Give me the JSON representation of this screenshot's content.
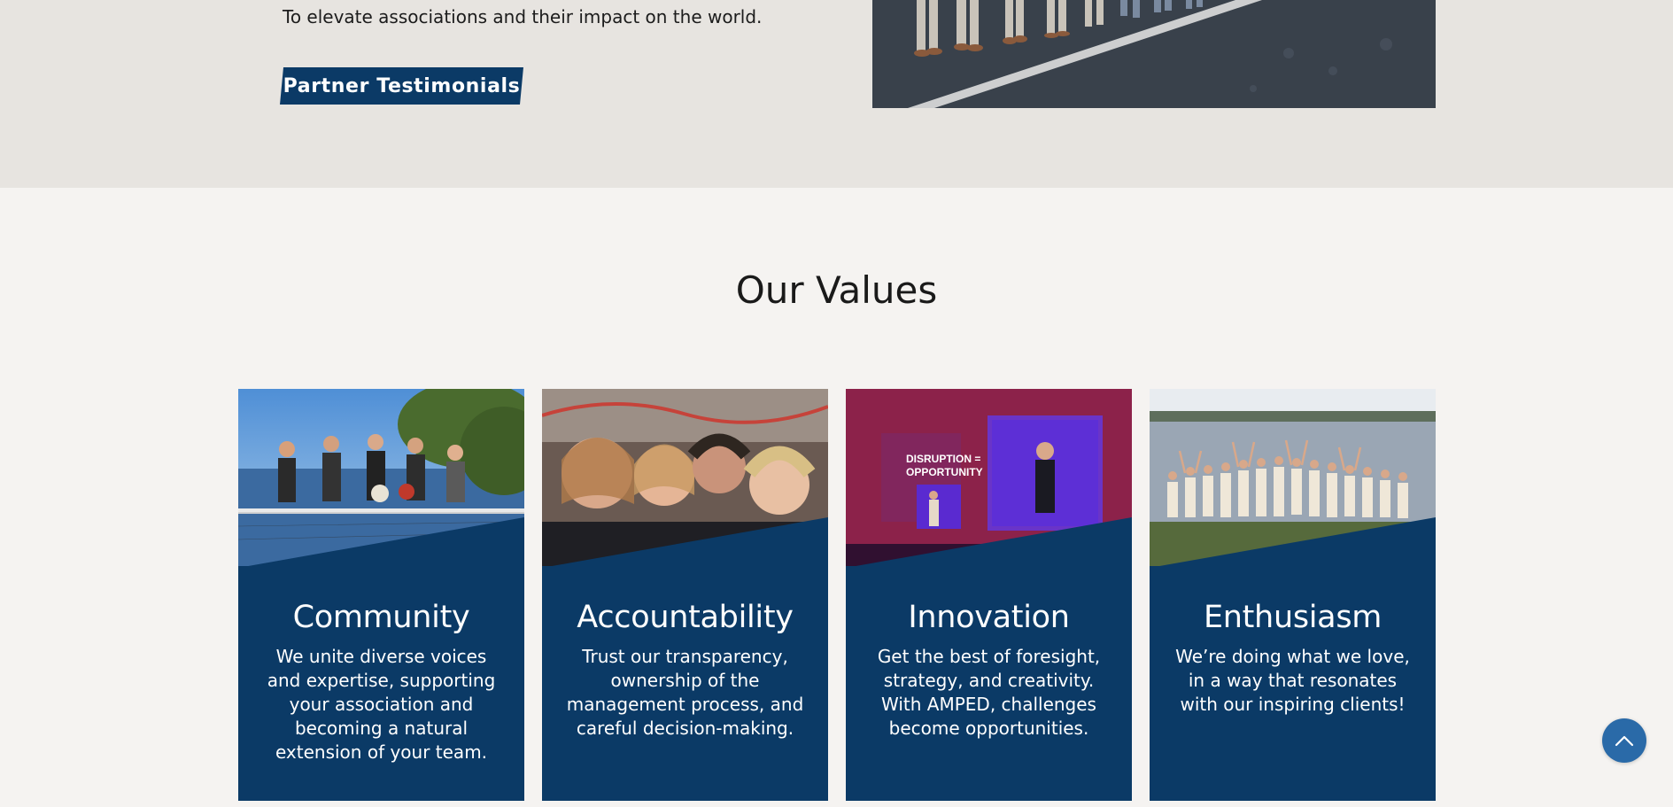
{
  "mission": {
    "text": "To elevate associations and their impact on the world."
  },
  "cta": {
    "testimonials_label": "Partner Testimonials"
  },
  "values": {
    "title": "Our Values",
    "cards": [
      {
        "title": "Community",
        "description": "We unite diverse voices and expertise, supporting your association and becoming a natural extension of your team."
      },
      {
        "title": "Accountability",
        "description": "Trust our transparency, ownership of the management process, and careful decision-making."
      },
      {
        "title": "Innovation",
        "description": "Get the best of foresight, strategy, and creativity. With AMPED, challenges become opportunities.",
        "photo_text": {
          "line1": "DISRUPTION =",
          "line2": "OPPORTUNITY"
        }
      },
      {
        "title": "Enthusiasm",
        "description": "We’re doing what we love, in a way that resonates with our inspiring clients!"
      }
    ]
  },
  "colors": {
    "brand_navy": "#0b3a66",
    "top_bg": "#e7e4e0",
    "page_bg": "#f5f3f1",
    "scroll_button": "#2a6aa8"
  },
  "icons": {
    "scroll_top": "chevron-up-icon"
  }
}
